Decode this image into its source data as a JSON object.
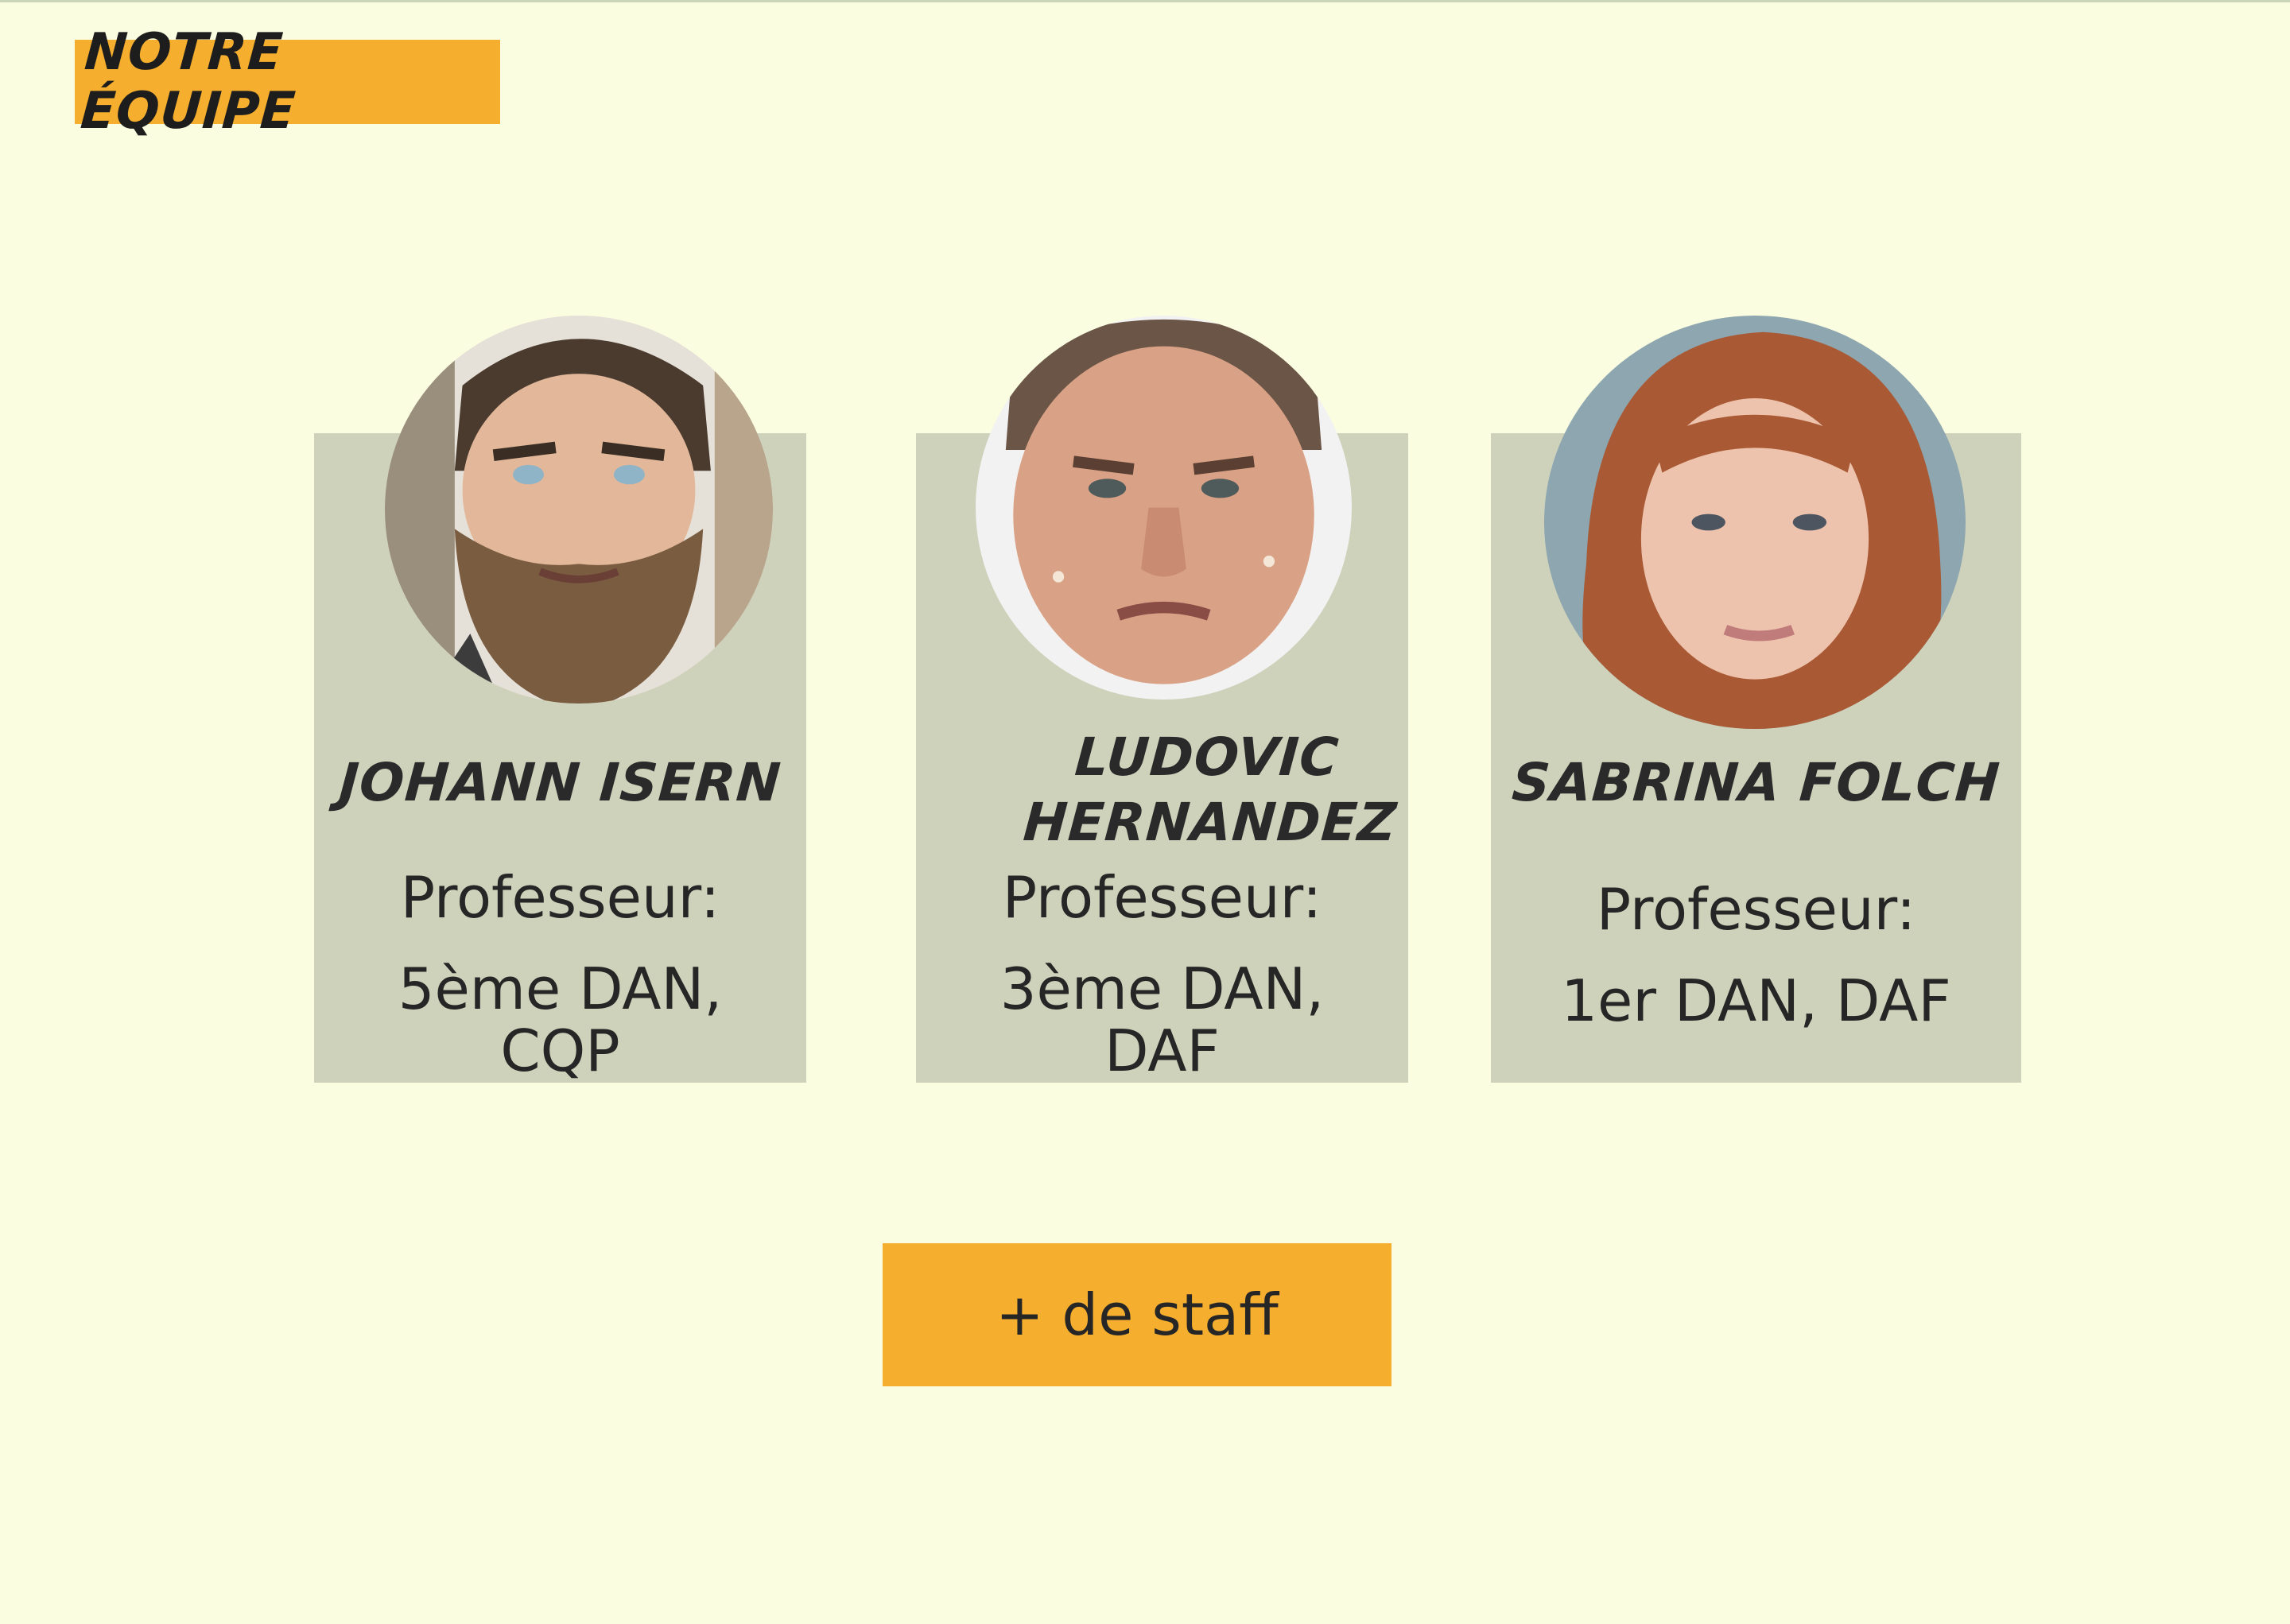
{
  "section": {
    "title": "NOTRE ÉQUIPE"
  },
  "team": [
    {
      "name": "JOHANN ISERN",
      "role": "Professeur:",
      "rank": "5ème DAN,\nCQP",
      "avatar_icon": "bearded-man-portrait"
    },
    {
      "name": "LUDOVIC\nHERNANDEZ",
      "role": "Professeur:",
      "rank": "3ème DAN,\nDAF",
      "avatar_icon": "short-hair-man-portrait"
    },
    {
      "name": "SABRINA FOLCH",
      "role": "Professeur:",
      "rank": "1er DAN, DAF",
      "avatar_icon": "red-hair-woman-portrait"
    }
  ],
  "more_button": {
    "label": "+ de staff"
  },
  "colors": {
    "background": "#fbfde0",
    "accent": "#f5ae2d",
    "card": "#cfd2bb",
    "text": "#262626"
  }
}
